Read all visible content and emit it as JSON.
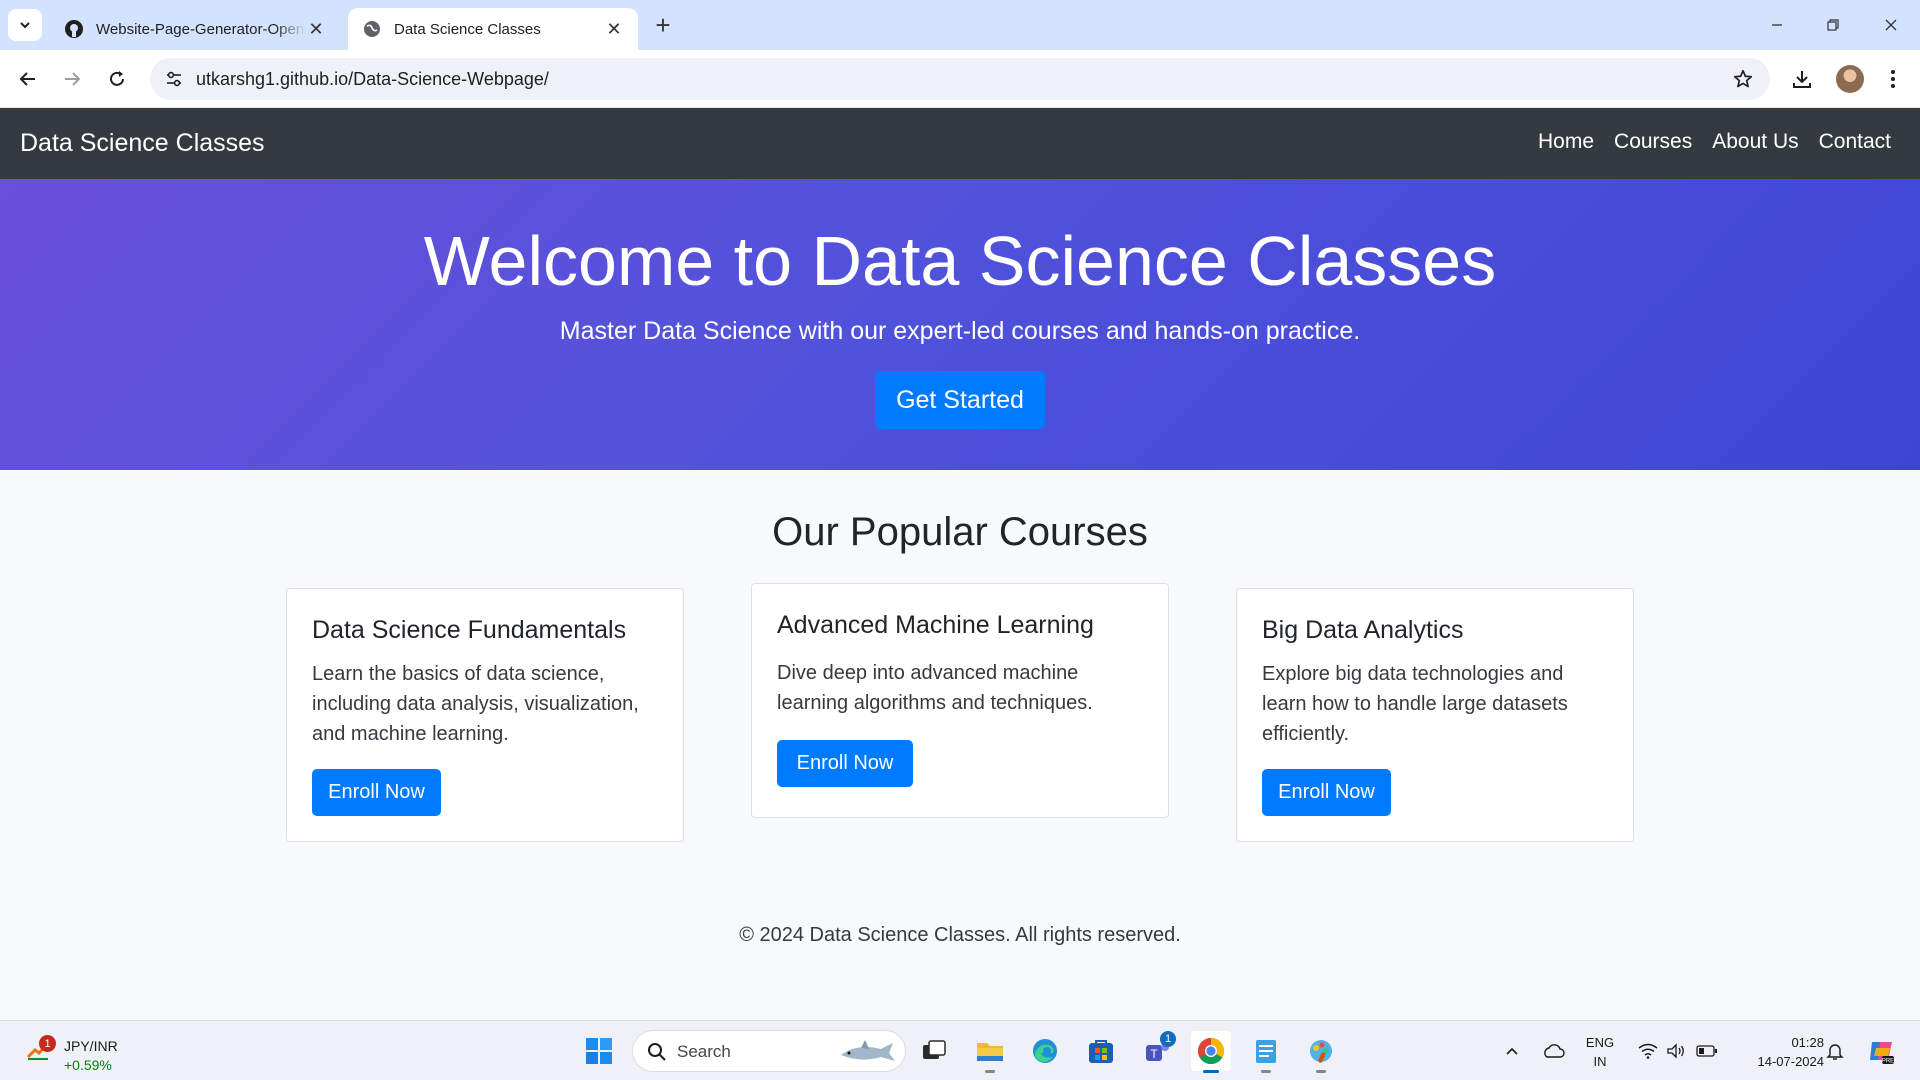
{
  "browser": {
    "tabs": [
      {
        "title": "Website-Page-Generator-OpenAI",
        "active": false
      },
      {
        "title": "Data Science Classes",
        "active": true
      }
    ],
    "url": "utkarshg1.github.io/Data-Science-Webpage/"
  },
  "page": {
    "brand": "Data Science Classes",
    "nav": [
      "Home",
      "Courses",
      "About Us",
      "Contact"
    ],
    "hero": {
      "title": "Welcome to Data Science Classes",
      "subtitle": "Master Data Science with our expert-led courses and hands-on practice.",
      "cta": "Get Started"
    },
    "section_title": "Our Popular Courses",
    "courses": [
      {
        "title": "Data Science Fundamentals",
        "description": "Learn the basics of data science, including data analysis, visualization, and machine learning.",
        "button": "Enroll Now"
      },
      {
        "title": "Advanced Machine Learning",
        "description": "Dive deep into advanced machine learning algorithms and techniques.",
        "button": "Enroll Now"
      },
      {
        "title": "Big Data Analytics",
        "description": "Explore big data technologies and learn how to handle large datasets efficiently.",
        "button": "Enroll Now"
      }
    ],
    "footer": "© 2024 Data Science Classes. All rights reserved."
  },
  "taskbar": {
    "widget": {
      "name": "JPY/INR",
      "change": "+0.59%",
      "badge": "1"
    },
    "search_label": "Search",
    "teams_badge": "1",
    "lang": [
      "ENG",
      "IN"
    ],
    "time": "01:28",
    "date": "14-07-2024"
  },
  "colors": {
    "navbar": "#343a40",
    "hero_start": "#6a4fd8",
    "hero_end": "#3e45d6",
    "primary": "#007bff",
    "tabbar": "#d3e3fd"
  }
}
